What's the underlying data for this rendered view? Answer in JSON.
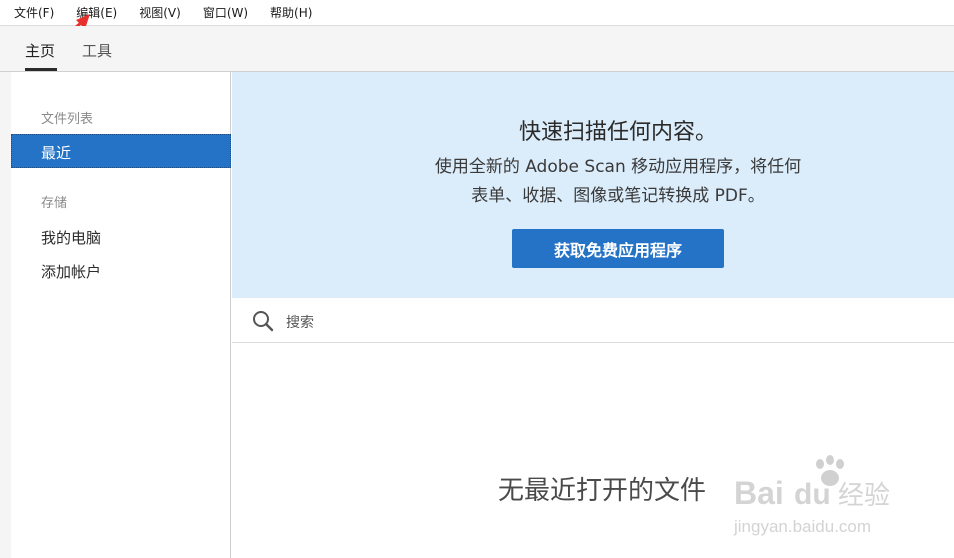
{
  "menubar": {
    "items": [
      "文件(F)",
      "编辑(E)",
      "视图(V)",
      "窗口(W)",
      "帮助(H)"
    ]
  },
  "tabs": {
    "home": "主页",
    "tools": "工具"
  },
  "sidebar": {
    "files_heading": "文件列表",
    "recent": "最近",
    "storage_heading": "存储",
    "my_computer": "我的电脑",
    "add_account": "添加帐户"
  },
  "banner": {
    "title": "快速扫描任何内容。",
    "line1": "使用全新的 Adobe Scan 移动应用程序，将任何",
    "line2": "表单、收据、图像或笔记转换成 PDF。",
    "cta": "获取免费应用程序"
  },
  "search": {
    "placeholder": "搜索"
  },
  "empty": {
    "message": "无最近打开的文件"
  },
  "watermark": {
    "brand": "Baidu经验",
    "url": "jingyan.baidu.com"
  },
  "colors": {
    "accent": "#2473c6",
    "banner_bg": "#dbecfa",
    "arrow": "#e8312d"
  }
}
